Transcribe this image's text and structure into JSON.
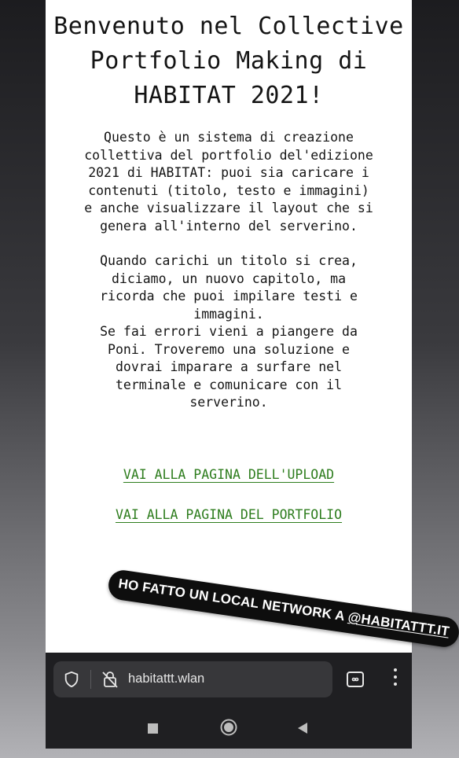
{
  "page": {
    "title_lines": [
      "Benvenuto nel Collective",
      "Portfolio Making di",
      "HABITAT 2021!"
    ],
    "intro_text": "Questo è un sistema di creazione\ncollettiva del portfolio del'edizione\n2021 di HABITAT: puoi sia caricare i\ncontenuti (titolo, testo e immagini)\ne anche visualizzare il layout che si\ngenera all'interno del serverino.",
    "note_text": "Quando carichi un titolo si crea,\ndiciamo, un nuovo capitolo, ma\nricorda che puoi impilare testi e\nimmagini.\nSe fai errori vieni a piangere da\nPoni. Troveremo una soluzione e\ndovrai imparare a surfare nel\nterminale e comunicare con il\nserverino.",
    "links": {
      "upload": "VAI ALLA PAGINA DELL'UPLOAD",
      "portfolio": "VAI ALLA PAGINA DEL PORTFOLIO"
    }
  },
  "browser": {
    "url": "habitattt.wlan",
    "icons": [
      "shield-icon",
      "insecure-lock-icon",
      "tabs-switcher-icon",
      "overflow-menu-icon"
    ]
  },
  "navbar": {
    "icons": [
      "recents-icon",
      "home-icon",
      "back-icon"
    ]
  },
  "sticker": {
    "text": "HO FATTO UN LOCAL NETWORK A ",
    "mention": "@HABITATTT.IT"
  },
  "colors": {
    "link": "#2e7d1e",
    "browser_bar": "#1f1f22",
    "url_pill": "#37373a",
    "sticker_bg": "#0e0e0e"
  }
}
